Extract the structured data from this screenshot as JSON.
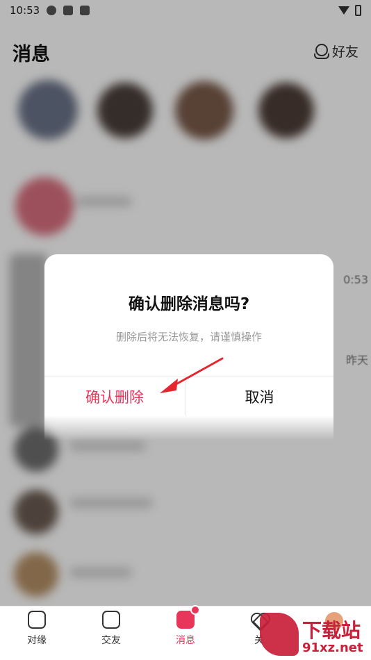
{
  "status_bar": {
    "time": "10:53"
  },
  "header": {
    "title": "消息",
    "friends_label": "好友"
  },
  "background": {
    "time_fragment": "0:53",
    "yesterday_fragment": "昨天"
  },
  "dialog": {
    "title": "确认删除消息吗?",
    "message": "删除后将无法恢复，请谨慎操作",
    "confirm_label": "确认删除",
    "cancel_label": "取消"
  },
  "bottom_nav": {
    "items": [
      {
        "label": "对缘",
        "icon": "info-icon"
      },
      {
        "label": "交友",
        "icon": "video-icon"
      },
      {
        "label": "消息",
        "icon": "message-icon",
        "active": true
      },
      {
        "label": "关",
        "icon": "heart-icon"
      }
    ]
  },
  "watermark": {
    "brand": "下载站",
    "site": "91xz.net"
  },
  "colors": {
    "accent": "#e8365a",
    "watermark": "#c8203a"
  }
}
